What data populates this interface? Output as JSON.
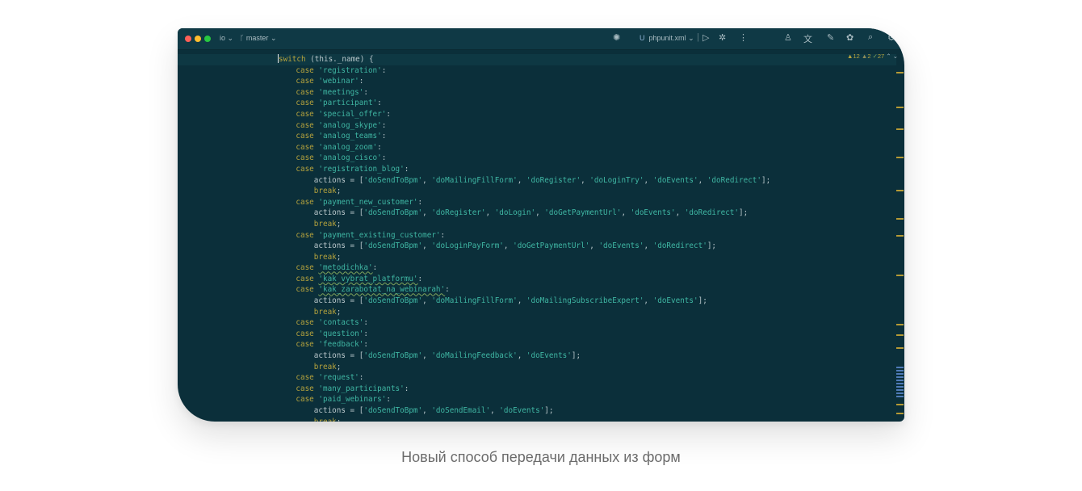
{
  "titlebar": {
    "project": "io",
    "branch_icon": "branch-icon",
    "branch": "master",
    "run_config": "phpunit.xml",
    "run_config_prefix": "U",
    "icons": [
      "run-icon",
      "debug-icon",
      "more-icon",
      "profile-icon",
      "translate-icon",
      "ai-icon",
      "plugin-icon",
      "search-icon",
      "settings-icon"
    ]
  },
  "inspections": {
    "warnings": "12",
    "weak_warnings": "2",
    "typos": "27"
  },
  "code_lines": [
    [
      [
        "kw",
        "switch"
      ],
      [
        "p",
        " (this._name) {"
      ]
    ],
    [
      [
        "p",
        "    "
      ],
      [
        "kw",
        "case"
      ],
      [
        "p",
        " "
      ],
      [
        "str",
        "'registration'"
      ],
      [
        "p",
        ":"
      ]
    ],
    [
      [
        "p",
        "    "
      ],
      [
        "kw",
        "case"
      ],
      [
        "p",
        " "
      ],
      [
        "str",
        "'webinar'"
      ],
      [
        "p",
        ":"
      ]
    ],
    [
      [
        "p",
        "    "
      ],
      [
        "kw",
        "case"
      ],
      [
        "p",
        " "
      ],
      [
        "str",
        "'meetings'"
      ],
      [
        "p",
        ":"
      ]
    ],
    [
      [
        "p",
        "    "
      ],
      [
        "kw",
        "case"
      ],
      [
        "p",
        " "
      ],
      [
        "str",
        "'participant'"
      ],
      [
        "p",
        ":"
      ]
    ],
    [
      [
        "p",
        "    "
      ],
      [
        "kw",
        "case"
      ],
      [
        "p",
        " "
      ],
      [
        "str",
        "'special_offer'"
      ],
      [
        "p",
        ":"
      ]
    ],
    [
      [
        "p",
        "    "
      ],
      [
        "kw",
        "case"
      ],
      [
        "p",
        " "
      ],
      [
        "str",
        "'analog_skype'"
      ],
      [
        "p",
        ":"
      ]
    ],
    [
      [
        "p",
        "    "
      ],
      [
        "kw",
        "case"
      ],
      [
        "p",
        " "
      ],
      [
        "str",
        "'analog_teams'"
      ],
      [
        "p",
        ":"
      ]
    ],
    [
      [
        "p",
        "    "
      ],
      [
        "kw",
        "case"
      ],
      [
        "p",
        " "
      ],
      [
        "str",
        "'analog_zoom'"
      ],
      [
        "p",
        ":"
      ]
    ],
    [
      [
        "p",
        "    "
      ],
      [
        "kw",
        "case"
      ],
      [
        "p",
        " "
      ],
      [
        "str",
        "'analog_cisco'"
      ],
      [
        "p",
        ":"
      ]
    ],
    [
      [
        "p",
        "    "
      ],
      [
        "kw",
        "case"
      ],
      [
        "p",
        " "
      ],
      [
        "str",
        "'registration_blog'"
      ],
      [
        "p",
        ":"
      ]
    ],
    [
      [
        "p",
        "        actions = ["
      ],
      [
        "str",
        "'doSendToBpm'"
      ],
      [
        "p",
        ", "
      ],
      [
        "str",
        "'doMailingFillForm'"
      ],
      [
        "p",
        ", "
      ],
      [
        "str",
        "'doRegister'"
      ],
      [
        "p",
        ", "
      ],
      [
        "str",
        "'doLoginTry'"
      ],
      [
        "p",
        ", "
      ],
      [
        "str",
        "'doEvents'"
      ],
      [
        "p",
        ", "
      ],
      [
        "str",
        "'doRedirect'"
      ],
      [
        "p",
        "];"
      ]
    ],
    [
      [
        "p",
        "        "
      ],
      [
        "brk",
        "break"
      ],
      [
        "p",
        ";"
      ]
    ],
    [
      [
        "p",
        "    "
      ],
      [
        "kw",
        "case"
      ],
      [
        "p",
        " "
      ],
      [
        "str",
        "'payment_new_customer'"
      ],
      [
        "p",
        ":"
      ]
    ],
    [
      [
        "p",
        "        actions = ["
      ],
      [
        "str",
        "'doSendToBpm'"
      ],
      [
        "p",
        ", "
      ],
      [
        "str",
        "'doRegister'"
      ],
      [
        "p",
        ", "
      ],
      [
        "str",
        "'doLogin'"
      ],
      [
        "p",
        ", "
      ],
      [
        "str",
        "'doGetPaymentUrl'"
      ],
      [
        "p",
        ", "
      ],
      [
        "str",
        "'doEvents'"
      ],
      [
        "p",
        ", "
      ],
      [
        "str",
        "'doRedirect'"
      ],
      [
        "p",
        "];"
      ]
    ],
    [
      [
        "p",
        "        "
      ],
      [
        "brk",
        "break"
      ],
      [
        "p",
        ";"
      ]
    ],
    [
      [
        "p",
        "    "
      ],
      [
        "kw",
        "case"
      ],
      [
        "p",
        " "
      ],
      [
        "str",
        "'payment_existing_customer'"
      ],
      [
        "p",
        ":"
      ]
    ],
    [
      [
        "p",
        "        actions = ["
      ],
      [
        "str",
        "'doSendToBpm'"
      ],
      [
        "p",
        ", "
      ],
      [
        "str",
        "'doLoginPayForm'"
      ],
      [
        "p",
        ", "
      ],
      [
        "str",
        "'doGetPaymentUrl'"
      ],
      [
        "p",
        ", "
      ],
      [
        "str",
        "'doEvents'"
      ],
      [
        "p",
        ", "
      ],
      [
        "str",
        "'doRedirect'"
      ],
      [
        "p",
        "];"
      ]
    ],
    [
      [
        "p",
        "        "
      ],
      [
        "brk",
        "break"
      ],
      [
        "p",
        ";"
      ]
    ],
    [
      [
        "p",
        "    "
      ],
      [
        "kw",
        "case"
      ],
      [
        "p",
        " "
      ],
      [
        "str",
        "'metodichka'"
      ],
      [
        "p",
        ":"
      ]
    ],
    [
      [
        "p",
        "    "
      ],
      [
        "kw",
        "case"
      ],
      [
        "p",
        " "
      ],
      [
        "str",
        "'kak_vybrat_platformu'"
      ],
      [
        "p",
        ":"
      ]
    ],
    [
      [
        "p",
        "    "
      ],
      [
        "kw",
        "case"
      ],
      [
        "p",
        " "
      ],
      [
        "str",
        "'kak_zarabotat_na_webinarah'"
      ],
      [
        "p",
        ":"
      ]
    ],
    [
      [
        "p",
        "        actions = ["
      ],
      [
        "str",
        "'doSendToBpm'"
      ],
      [
        "p",
        ", "
      ],
      [
        "str",
        "'doMailingFillForm'"
      ],
      [
        "p",
        ", "
      ],
      [
        "str",
        "'doMailingSubscribeExpert'"
      ],
      [
        "p",
        ", "
      ],
      [
        "str",
        "'doEvents'"
      ],
      [
        "p",
        "];"
      ]
    ],
    [
      [
        "p",
        "        "
      ],
      [
        "brk",
        "break"
      ],
      [
        "p",
        ";"
      ]
    ],
    [
      [
        "p",
        "    "
      ],
      [
        "kw",
        "case"
      ],
      [
        "p",
        " "
      ],
      [
        "str",
        "'contacts'"
      ],
      [
        "p",
        ":"
      ]
    ],
    [
      [
        "p",
        "    "
      ],
      [
        "kw",
        "case"
      ],
      [
        "p",
        " "
      ],
      [
        "str",
        "'question'"
      ],
      [
        "p",
        ":"
      ]
    ],
    [
      [
        "p",
        "    "
      ],
      [
        "kw",
        "case"
      ],
      [
        "p",
        " "
      ],
      [
        "str",
        "'feedback'"
      ],
      [
        "p",
        ":"
      ]
    ],
    [
      [
        "p",
        "        actions = ["
      ],
      [
        "str",
        "'doSendToBpm'"
      ],
      [
        "p",
        ", "
      ],
      [
        "str",
        "'doMailingFeedback'"
      ],
      [
        "p",
        ", "
      ],
      [
        "str",
        "'doEvents'"
      ],
      [
        "p",
        "];"
      ]
    ],
    [
      [
        "p",
        "        "
      ],
      [
        "brk",
        "break"
      ],
      [
        "p",
        ";"
      ]
    ],
    [
      [
        "p",
        "    "
      ],
      [
        "kw",
        "case"
      ],
      [
        "p",
        " "
      ],
      [
        "str",
        "'request'"
      ],
      [
        "p",
        ":"
      ]
    ],
    [
      [
        "p",
        "    "
      ],
      [
        "kw",
        "case"
      ],
      [
        "p",
        " "
      ],
      [
        "str",
        "'many_participants'"
      ],
      [
        "p",
        ":"
      ]
    ],
    [
      [
        "p",
        "    "
      ],
      [
        "kw",
        "case"
      ],
      [
        "p",
        " "
      ],
      [
        "str",
        "'paid_webinars'"
      ],
      [
        "p",
        ":"
      ]
    ],
    [
      [
        "p",
        "        actions = ["
      ],
      [
        "str",
        "'doSendToBpm'"
      ],
      [
        "p",
        ", "
      ],
      [
        "str",
        "'doSendEmail'"
      ],
      [
        "p",
        ", "
      ],
      [
        "str",
        "'doEvents'"
      ],
      [
        "p",
        "];"
      ]
    ],
    [
      [
        "p",
        "        "
      ],
      [
        "brk",
        "break"
      ],
      [
        "p",
        ";"
      ]
    ]
  ],
  "caption": "Новый способ передачи данных из форм",
  "colors": {
    "editor_bg": "#0b2f3a",
    "keyword": "#b6a33d",
    "string": "#3fb6a3",
    "text": "#b9c7cb"
  }
}
